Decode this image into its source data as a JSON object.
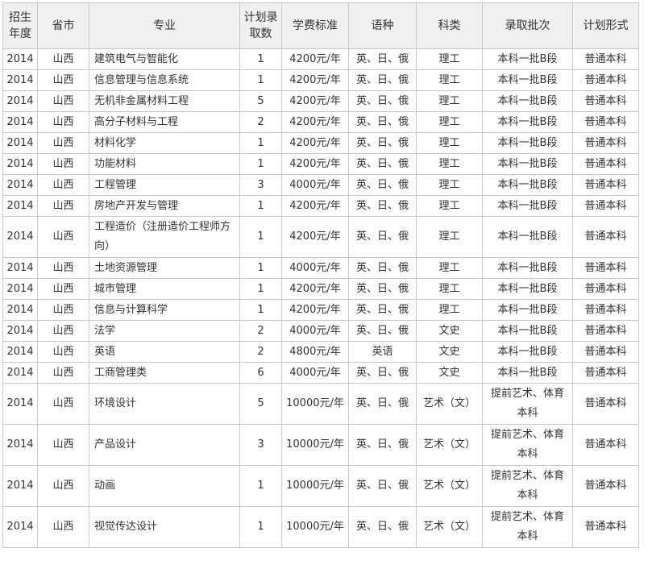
{
  "headers": {
    "year": "招生年度",
    "province": "省市",
    "major": "专业",
    "plan": "计划录取数",
    "fee": "学费标准",
    "language": "语种",
    "category": "科类",
    "batch": "录取批次",
    "form": "计划形式"
  },
  "rows": [
    {
      "year": "2014",
      "province": "山西",
      "major": "建筑电气与智能化",
      "plan": "1",
      "fee": "4200元/年",
      "language": "英、日、俄",
      "category": "理工",
      "batch": "本科一批B段",
      "form": "普通本科"
    },
    {
      "year": "2014",
      "province": "山西",
      "major": "信息管理与信息系统",
      "plan": "1",
      "fee": "4200元/年",
      "language": "英、日、俄",
      "category": "理工",
      "batch": "本科一批B段",
      "form": "普通本科"
    },
    {
      "year": "2014",
      "province": "山西",
      "major": "无机非金属材料工程",
      "plan": "5",
      "fee": "4200元/年",
      "language": "英、日、俄",
      "category": "理工",
      "batch": "本科一批B段",
      "form": "普通本科"
    },
    {
      "year": "2014",
      "province": "山西",
      "major": "高分子材料与工程",
      "plan": "2",
      "fee": "4200元/年",
      "language": "英、日、俄",
      "category": "理工",
      "batch": "本科一批B段",
      "form": "普通本科"
    },
    {
      "year": "2014",
      "province": "山西",
      "major": "材料化学",
      "plan": "1",
      "fee": "4200元/年",
      "language": "英、日、俄",
      "category": "理工",
      "batch": "本科一批B段",
      "form": "普通本科"
    },
    {
      "year": "2014",
      "province": "山西",
      "major": "功能材料",
      "plan": "1",
      "fee": "4200元/年",
      "language": "英、日、俄",
      "category": "理工",
      "batch": "本科一批B段",
      "form": "普通本科"
    },
    {
      "year": "2014",
      "province": "山西",
      "major": "工程管理",
      "plan": "3",
      "fee": "4000元/年",
      "language": "英、日、俄",
      "category": "理工",
      "batch": "本科一批B段",
      "form": "普通本科"
    },
    {
      "year": "2014",
      "province": "山西",
      "major": "房地产开发与管理",
      "plan": "1",
      "fee": "4200元/年",
      "language": "英、日、俄",
      "category": "理工",
      "batch": "本科一批B段",
      "form": "普通本科"
    },
    {
      "year": "2014",
      "province": "山西",
      "major": "工程造价（注册造价工程师方向）",
      "plan": "1",
      "fee": "4200元/年",
      "language": "英、日、俄",
      "category": "理工",
      "batch": "本科一批B段",
      "form": "普通本科"
    },
    {
      "year": "2014",
      "province": "山西",
      "major": "土地资源管理",
      "plan": "1",
      "fee": "4000元/年",
      "language": "英、日、俄",
      "category": "理工",
      "batch": "本科一批B段",
      "form": "普通本科"
    },
    {
      "year": "2014",
      "province": "山西",
      "major": "城市管理",
      "plan": "1",
      "fee": "4200元/年",
      "language": "英、日、俄",
      "category": "理工",
      "batch": "本科一批B段",
      "form": "普通本科"
    },
    {
      "year": "2014",
      "province": "山西",
      "major": "信息与计算科学",
      "plan": "1",
      "fee": "4200元/年",
      "language": "英、日、俄",
      "category": "理工",
      "batch": "本科一批B段",
      "form": "普通本科"
    },
    {
      "year": "2014",
      "province": "山西",
      "major": "法学",
      "plan": "2",
      "fee": "4000元/年",
      "language": "英、日、俄",
      "category": "文史",
      "batch": "本科一批B段",
      "form": "普通本科"
    },
    {
      "year": "2014",
      "province": "山西",
      "major": "英语",
      "plan": "2",
      "fee": "4800元/年",
      "language": "英语",
      "category": "文史",
      "batch": "本科一批B段",
      "form": "普通本科"
    },
    {
      "year": "2014",
      "province": "山西",
      "major": "工商管理类",
      "plan": "6",
      "fee": "4000元/年",
      "language": "英、日、俄",
      "category": "文史",
      "batch": "本科一批B段",
      "form": "普通本科"
    },
    {
      "year": "2014",
      "province": "山西",
      "major": "环境设计",
      "plan": "5",
      "fee": "10000元/年",
      "language": "英、日、俄",
      "category": "艺术（文）",
      "batch": "提前艺术、体育本科",
      "form": "普通本科"
    },
    {
      "year": "2014",
      "province": "山西",
      "major": "产品设计",
      "plan": "3",
      "fee": "10000元/年",
      "language": "英、日、俄",
      "category": "艺术（文）",
      "batch": "提前艺术、体育本科",
      "form": "普通本科"
    },
    {
      "year": "2014",
      "province": "山西",
      "major": "动画",
      "plan": "1",
      "fee": "10000元/年",
      "language": "英、日、俄",
      "category": "艺术（文）",
      "batch": "提前艺术、体育本科",
      "form": "普通本科"
    },
    {
      "year": "2014",
      "province": "山西",
      "major": "视觉传达设计",
      "plan": "1",
      "fee": "10000元/年",
      "language": "英、日、俄",
      "category": "艺术（文）",
      "batch": "提前艺术、体育本科",
      "form": "普通本科"
    }
  ]
}
